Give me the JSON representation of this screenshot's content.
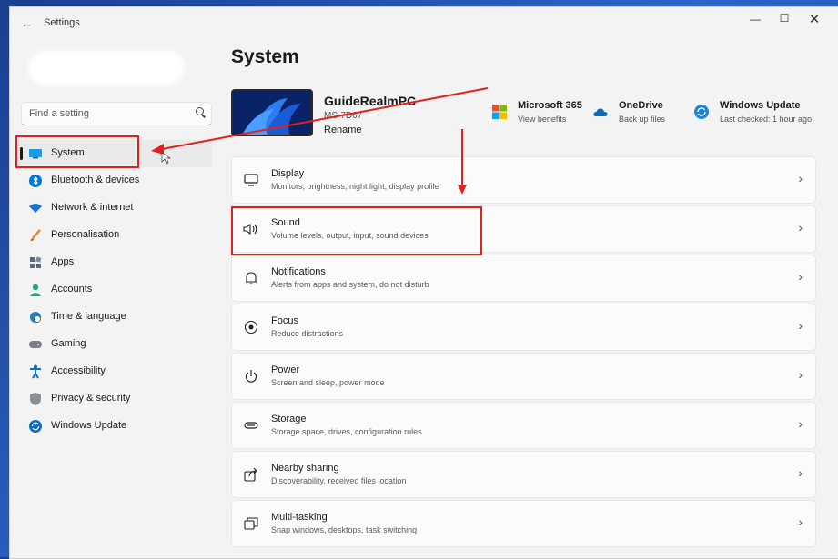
{
  "window": {
    "title": "Settings",
    "back_icon": "arrow-left-icon",
    "controls": [
      "minimize-icon",
      "maximize-icon",
      "close-icon"
    ]
  },
  "sidebar": {
    "search_placeholder": "Find a setting",
    "items": [
      {
        "label": "System",
        "icon": "display-icon",
        "color": "#0078d4",
        "active": true
      },
      {
        "label": "Bluetooth & devices",
        "icon": "bluetooth-icon",
        "color": "#0078d4"
      },
      {
        "label": "Network & internet",
        "icon": "wifi-icon",
        "color": "#0b68c5"
      },
      {
        "label": "Personalisation",
        "icon": "brush-icon",
        "color": "#d9822b"
      },
      {
        "label": "Apps",
        "icon": "apps-icon",
        "color": "#5b6b7f"
      },
      {
        "label": "Accounts",
        "icon": "person-icon",
        "color": "#2aa87a"
      },
      {
        "label": "Time & language",
        "icon": "globe-clock-icon",
        "color": "#1f7fc8"
      },
      {
        "label": "Gaming",
        "icon": "gamepad-icon",
        "color": "#7a7f86"
      },
      {
        "label": "Accessibility",
        "icon": "accessibility-icon",
        "color": "#0f6cbd"
      },
      {
        "label": "Privacy & security",
        "icon": "shield-icon",
        "color": "#7a7f86"
      },
      {
        "label": "Windows Update",
        "icon": "update-icon",
        "color": "#0f6cbd"
      }
    ]
  },
  "main": {
    "title": "System",
    "pc": {
      "name": "GuideRealmPC",
      "model": "MS-7D67",
      "rename": "Rename"
    },
    "quick": [
      {
        "title": "Microsoft 365",
        "sub": "View benefits",
        "icon": "microsoft-logo-icon"
      },
      {
        "title": "OneDrive",
        "sub": "Back up files",
        "icon": "cloud-icon"
      },
      {
        "title": "Windows Update",
        "sub": "Last checked: 1 hour ago",
        "icon": "update-icon"
      }
    ],
    "cards": [
      {
        "title": "Display",
        "sub": "Monitors, brightness, night light, display profile",
        "icon": "monitor-icon"
      },
      {
        "title": "Sound",
        "sub": "Volume levels, output, input, sound devices",
        "icon": "speaker-icon"
      },
      {
        "title": "Notifications",
        "sub": "Alerts from apps and system, do not disturb",
        "icon": "bell-icon"
      },
      {
        "title": "Focus",
        "sub": "Reduce distractions",
        "icon": "focus-icon"
      },
      {
        "title": "Power",
        "sub": "Screen and sleep, power mode",
        "icon": "power-icon"
      },
      {
        "title": "Storage",
        "sub": "Storage space, drives, configuration rules",
        "icon": "storage-icon"
      },
      {
        "title": "Nearby sharing",
        "sub": "Discoverability, received files location",
        "icon": "share-icon"
      },
      {
        "title": "Multi-tasking",
        "sub": "Snap windows, desktops, task switching",
        "icon": "multitask-icon"
      }
    ]
  },
  "annotation_color": "#e2211c"
}
